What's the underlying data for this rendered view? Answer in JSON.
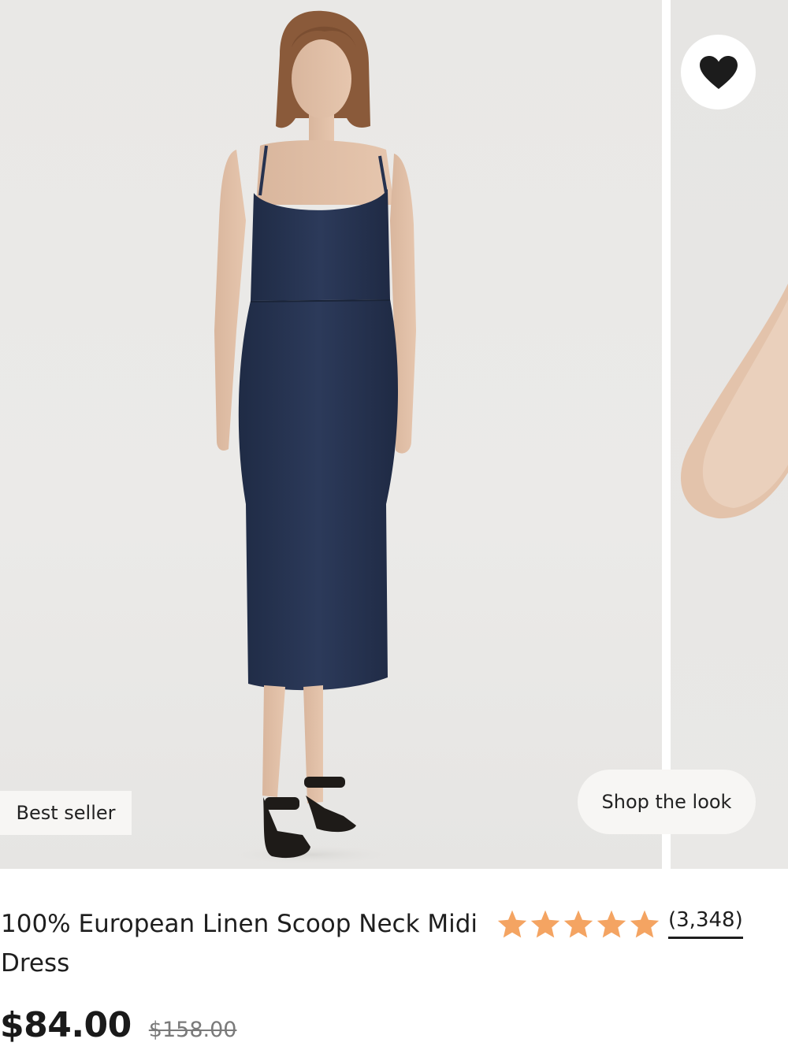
{
  "gallery": {
    "badge": "Best seller",
    "shop_the_look": "Shop the look",
    "favorite_icon": "heart-icon"
  },
  "product": {
    "title": "100% European Linen Scoop Neck Midi Dress",
    "rating": {
      "stars": 5,
      "review_count": "(3,348)",
      "star_color": "#f4a462"
    },
    "price": "$84.00",
    "original_price": "$158.00"
  },
  "colors": {
    "dress_navy": "#25324f",
    "background": "#ebeae8"
  }
}
